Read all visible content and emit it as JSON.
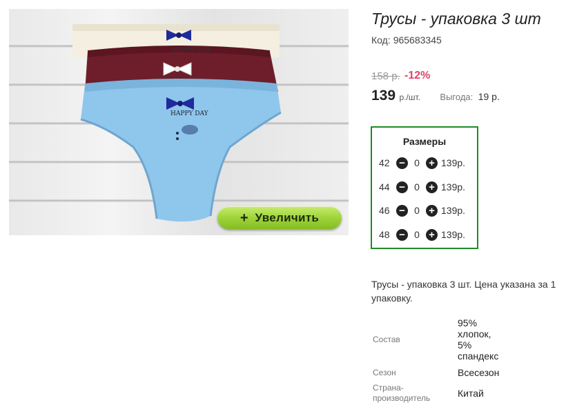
{
  "product": {
    "title": "Трусы - упаковка 3 шт",
    "code_label": "Код:",
    "code": "965683345",
    "old_price": "158 р.",
    "discount": "-12%",
    "price": "139",
    "price_unit": "р./шт.",
    "savings_label": "Выгода:",
    "savings_value": "19 р."
  },
  "image": {
    "zoom_plus": "+",
    "zoom_label": "Увеличить",
    "print_text": "HAPPY DAY"
  },
  "sizes": {
    "title": "Размеры",
    "items": [
      {
        "size": "42",
        "qty": "0",
        "price": "139р."
      },
      {
        "size": "44",
        "qty": "0",
        "price": "139р."
      },
      {
        "size": "46",
        "qty": "0",
        "price": "139р."
      },
      {
        "size": "48",
        "qty": "0",
        "price": "139р."
      }
    ]
  },
  "description": "Трусы - упаковка 3 шт. Цена указана за 1 упаковку.",
  "specs": {
    "composition_label": "Состав",
    "composition_value": "95% хлопок, 5% спандекс",
    "season_label": "Сезон",
    "season_value": "Всесезон",
    "country_label": "Страна-производитель",
    "country_value": "Китай"
  },
  "colors": {
    "accent_green": "#1e8b24",
    "discount_red": "#e0436a",
    "zoom_button": "#9fd43b"
  }
}
